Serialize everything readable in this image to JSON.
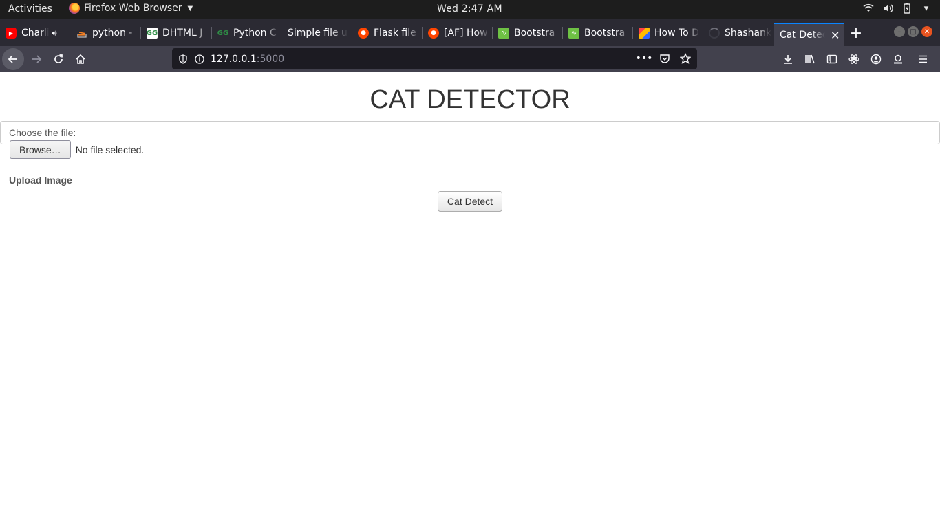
{
  "system_bar": {
    "activities": "Activities",
    "app_name": "Firefox Web Browser",
    "clock": "Wed  2:47 AM"
  },
  "tabs": [
    {
      "title": "Charlie",
      "icon": "youtube-icon"
    },
    {
      "title": "python - ",
      "icon": "stackoverflow-icon"
    },
    {
      "title": "DHTML J",
      "icon": "geeksforgeeks-icon"
    },
    {
      "title": "Python C",
      "icon": "geeksforgeeks-icon"
    },
    {
      "title": "Simple file u",
      "icon": "none"
    },
    {
      "title": "Flask file",
      "icon": "reddit-icon"
    },
    {
      "title": "[AF] How",
      "icon": "reddit-icon"
    },
    {
      "title": "Bootstra",
      "icon": "bootsnipp-icon"
    },
    {
      "title": "Bootstra",
      "icon": "bootsnipp-icon"
    },
    {
      "title": "How To D",
      "icon": "colorful-icon"
    },
    {
      "title": "Shashank",
      "icon": "loading-icon"
    }
  ],
  "active_tab": {
    "title": "Cat Detector"
  },
  "urlbar": {
    "host": "127.0.0.1",
    "port": ":5000"
  },
  "page": {
    "heading": "CAT DETECTOR",
    "file_label": "Choose the file:",
    "browse_label": "Browse…",
    "no_file_text": "No file selected.",
    "upload_label": "Upload Image",
    "detect_button": "Cat Detect"
  },
  "colors": {
    "tabstrip_bg": "#2b2a33",
    "toolbar_bg": "#42414d",
    "accent": "#0a84ff",
    "text_dark": "#333333"
  }
}
